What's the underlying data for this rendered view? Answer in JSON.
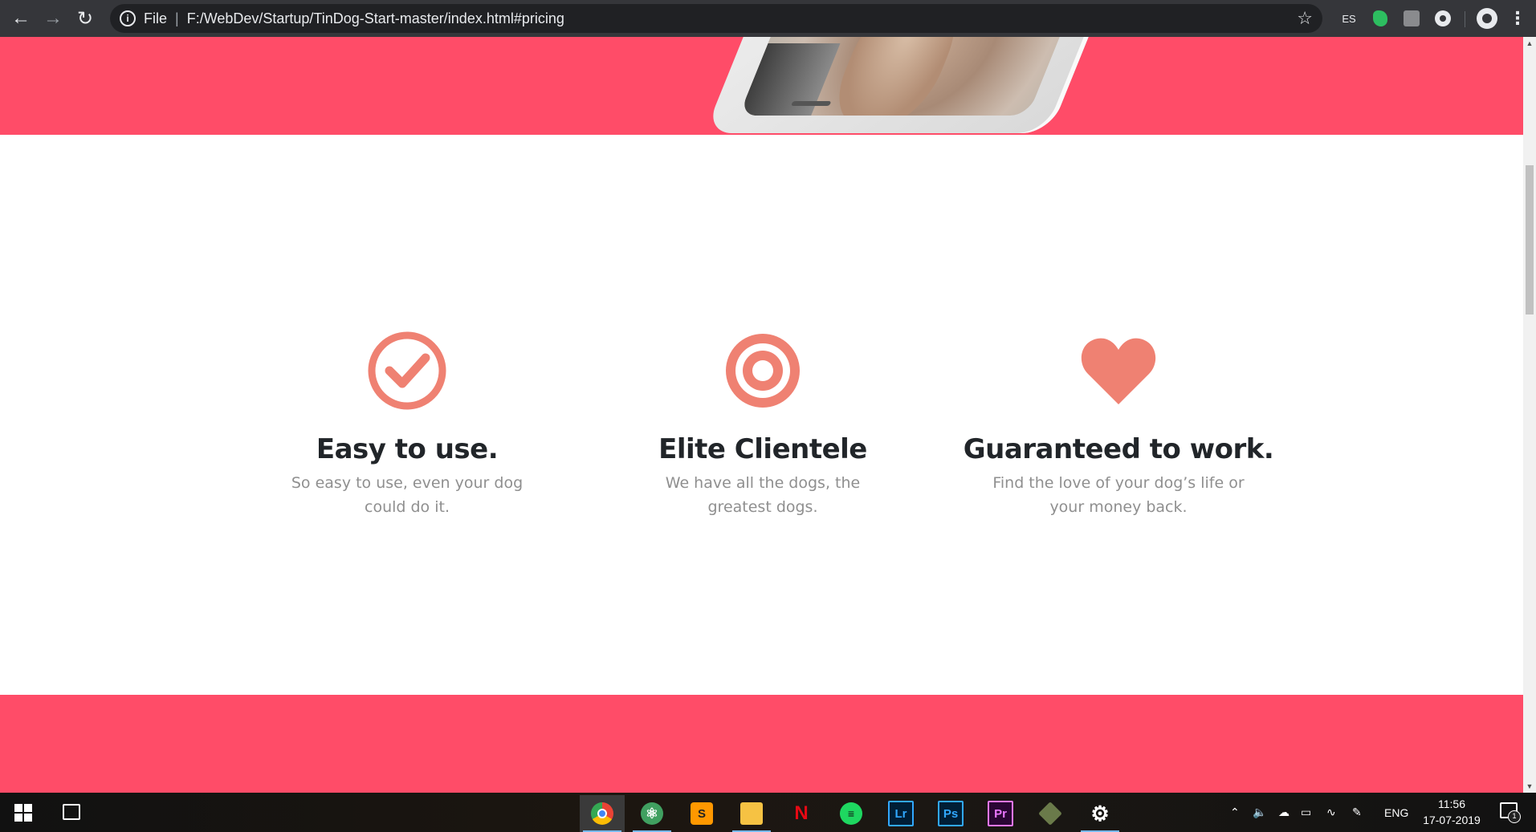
{
  "browser": {
    "url_scheme": "File",
    "url_separator": "|",
    "url_path": "F:/WebDev/Startup/TinDog-Start-master/index.html#pricing",
    "extension_es": "ES"
  },
  "page": {
    "brand_color": "#ff4c68",
    "icon_color": "#ef8172",
    "features": [
      {
        "icon": "check-circle-icon",
        "title": "Easy to use.",
        "text": "So easy to use, even your dog could do it."
      },
      {
        "icon": "bullseye-icon",
        "title": "Elite Clientele",
        "text": "We have all the dogs, the greatest dogs."
      },
      {
        "icon": "heart-icon",
        "title": "Guaranteed to work.",
        "text": "Find the love of your dog’s life or your money back."
      }
    ]
  },
  "taskbar": {
    "apps": [
      "Chrome",
      "Atom",
      "Sublime Text",
      "File Explorer",
      "Netflix",
      "Spotify",
      "Lightroom",
      "Photoshop",
      "Premiere Pro",
      "App",
      "Settings"
    ],
    "lr_label": "Lr",
    "ps_label": "Ps",
    "pr_label": "Pr",
    "language": "ENG",
    "time": "11:56",
    "date": "17-07-2019",
    "notification_count": "1"
  }
}
